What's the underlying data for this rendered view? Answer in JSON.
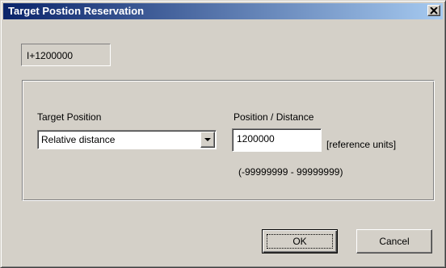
{
  "window": {
    "title": "Target Postion Reservation",
    "close_icon": "close-icon"
  },
  "counter": {
    "value": "I+1200000"
  },
  "target_position": {
    "label": "Target Position",
    "selected": "Relative distance",
    "arrow_icon": "chevron-down-icon"
  },
  "position_distance": {
    "label": "Position / Distance",
    "value": "1200000",
    "unit": "[reference units]",
    "range": "(-99999999 - 99999999)"
  },
  "buttons": {
    "ok": "OK",
    "cancel": "Cancel"
  },
  "colors": {
    "face": "#d4d0c8",
    "title_start": "#0a246a",
    "title_end": "#a6caf0"
  }
}
